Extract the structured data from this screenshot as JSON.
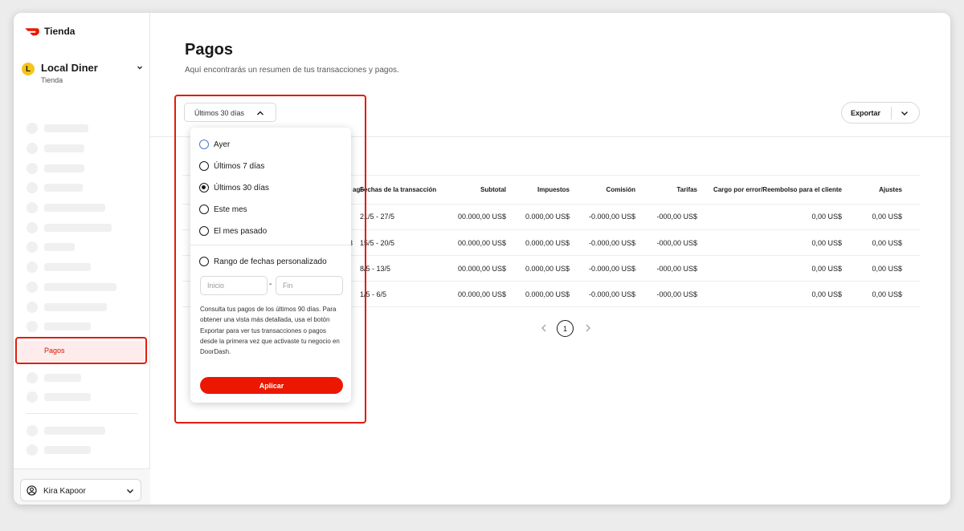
{
  "brand": {
    "name": "Tienda"
  },
  "store": {
    "initial": "L",
    "name": "Local Diner",
    "type": "Tienda"
  },
  "sidebar": {
    "active_item": "Pagos"
  },
  "user": {
    "name": "Kira Kapoor"
  },
  "page": {
    "title": "Pagos",
    "subtitle": "Aquí encontrarás un resumen de tus transacciones y pagos."
  },
  "filter": {
    "selected_label": "Últimos 30 días"
  },
  "export": {
    "label": "Exportar"
  },
  "dropdown": {
    "options": [
      {
        "label": "Ayer"
      },
      {
        "label": "Últimos 7 días"
      },
      {
        "label": "Últimos 30 días"
      },
      {
        "label": "Este mes"
      },
      {
        "label": "El mes pasado"
      }
    ],
    "custom_range_label": "Rango de fechas personalizado",
    "start_placeholder": "Inicio",
    "end_placeholder": "Fin",
    "separator": "-",
    "info": "Consulta tus pagos de los últimos 90 días. Para obtener una vista más detallada, usa el botón Exportar para ver tus transacciones o pagos desde la primera vez que activaste tu negocio en DoorDash.",
    "apply_label": "Aplicar"
  },
  "table": {
    "partial_header": "ago",
    "headers": {
      "dates": "Fechas de la transacción",
      "subtotal": "Subtotal",
      "taxes": "Impuestos",
      "commission": "Comisión",
      "fees": "Tarifas",
      "error_charge": "Cargo por error/Reembolso para el cliente",
      "adjustments": "Ajustes"
    },
    "rows": [
      {
        "partial": "",
        "dates": "21/5 - 27/5",
        "subtotal": "00.000,00 US$",
        "taxes": "0.000,00 US$",
        "commission": "-0.000,00 US$",
        "fees": "-000,00 US$",
        "error_charge": "0,00 US$",
        "adjustments": "0,00 US$"
      },
      {
        "partial": "3",
        "dates": "15/5 - 20/5",
        "subtotal": "00.000,00 US$",
        "taxes": "0.000,00 US$",
        "commission": "-0.000,00 US$",
        "fees": "-000,00 US$",
        "error_charge": "0,00 US$",
        "adjustments": "0,00 US$"
      },
      {
        "partial": "",
        "dates": "8/5 - 13/5",
        "subtotal": "00.000,00 US$",
        "taxes": "0.000,00 US$",
        "commission": "-0.000,00 US$",
        "fees": "-000,00 US$",
        "error_charge": "0,00 US$",
        "adjustments": "0,00 US$"
      },
      {
        "partial": "",
        "dates": "1/5 - 6/5",
        "subtotal": "00.000,00 US$",
        "taxes": "0.000,00 US$",
        "commission": "-0.000,00 US$",
        "fees": "-000,00 US$",
        "error_charge": "0,00 US$",
        "adjustments": "0,00 US$"
      }
    ]
  },
  "pagination": {
    "current": "1"
  },
  "colors": {
    "accent": "#eb1700",
    "highlight": "#e31b0c",
    "active_bg": "#fdeceb"
  }
}
